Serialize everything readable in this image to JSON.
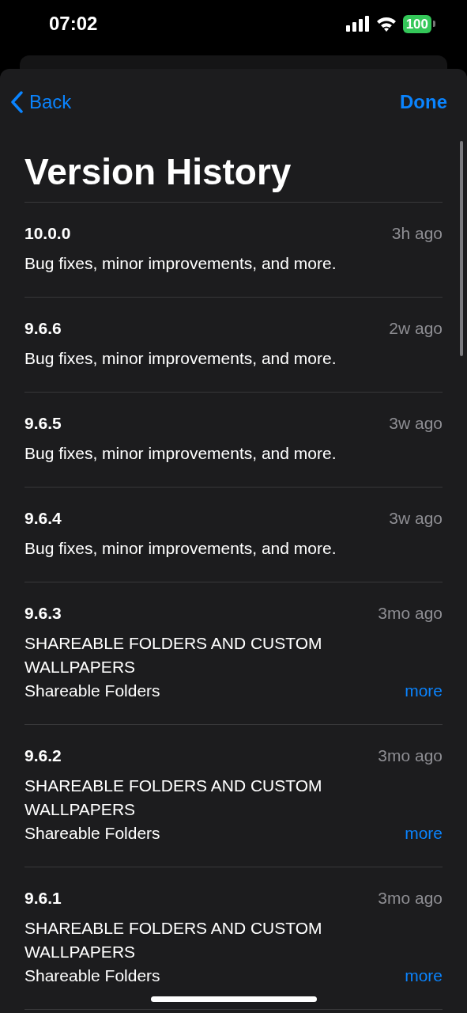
{
  "status_bar": {
    "time": "07:02",
    "battery": "100"
  },
  "nav": {
    "back": "Back",
    "done": "Done"
  },
  "title": "Version History",
  "versions": [
    {
      "version": "10.0.0",
      "date": "3h ago",
      "notes": "Bug fixes, minor improvements, and more."
    },
    {
      "version": "9.6.6",
      "date": "2w ago",
      "notes": "Bug fixes, minor improvements, and more."
    },
    {
      "version": "9.6.5",
      "date": "3w ago",
      "notes": "Bug fixes, minor improvements, and more."
    },
    {
      "version": "9.6.4",
      "date": "3w ago",
      "notes": "Bug fixes, minor improvements, and more."
    },
    {
      "version": "9.6.3",
      "date": "3mo ago",
      "headline": "SHAREABLE FOLDERS AND CUSTOM WALLPAPERS",
      "notes": "Shareable Folders",
      "more": "more"
    },
    {
      "version": "9.6.2",
      "date": "3mo ago",
      "headline": "SHAREABLE FOLDERS AND CUSTOM WALLPAPERS",
      "notes": "Shareable Folders",
      "more": "more"
    },
    {
      "version": "9.6.1",
      "date": "3mo ago",
      "headline": "SHAREABLE FOLDERS AND CUSTOM WALLPAPERS",
      "notes": "Shareable Folders",
      "more": "more"
    }
  ]
}
